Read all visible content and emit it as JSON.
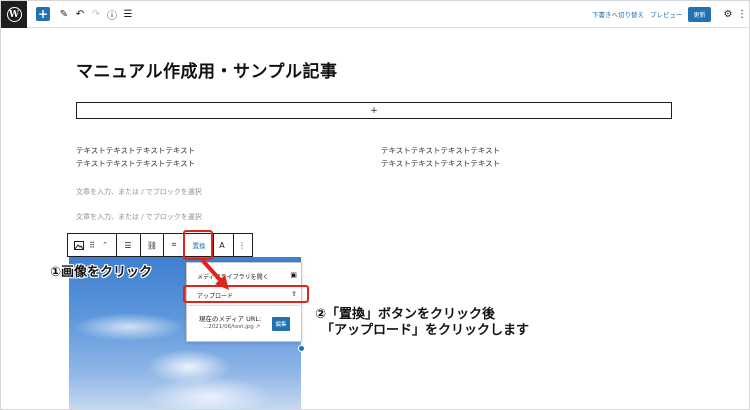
{
  "topbar": {
    "logo": "wordpress-logo",
    "add_block": "+",
    "save_draft": "下書きへ切り替え",
    "preview": "プレビュー",
    "update": "更新"
  },
  "editor": {
    "title": "マニュアル作成用・サンプル記事",
    "appender": "+",
    "col_left": [
      "テキストテキストテキストテキスト",
      "テキストテキストテキストテキスト"
    ],
    "col_right": [
      "テキストテキストテキストテキスト",
      "テキストテキストテキストテキスト"
    ],
    "placeholder1": "文章を入力、または / でブロックを選択",
    "placeholder2": "文章を入力、または / でブロックを選択"
  },
  "block_toolbar": {
    "replace": "置換",
    "text_tool": "A",
    "more": "⋮"
  },
  "dropdown": {
    "open_library": "メディアライブラリを開く",
    "upload": "アップロード",
    "current_media_label": "現在のメディア URL:",
    "current_media_path": "...2021/06/test.jpg",
    "edit": "編集"
  },
  "annotations": {
    "step1": "①画像をクリック",
    "step2_line1": "②「置換」ボタンをクリック後",
    "step2_line2": "「アップロード」をクリックします",
    "highlight_color": "#e2231a"
  },
  "colors": {
    "accent": "#2271b1",
    "annotation_red": "#e2231a"
  }
}
